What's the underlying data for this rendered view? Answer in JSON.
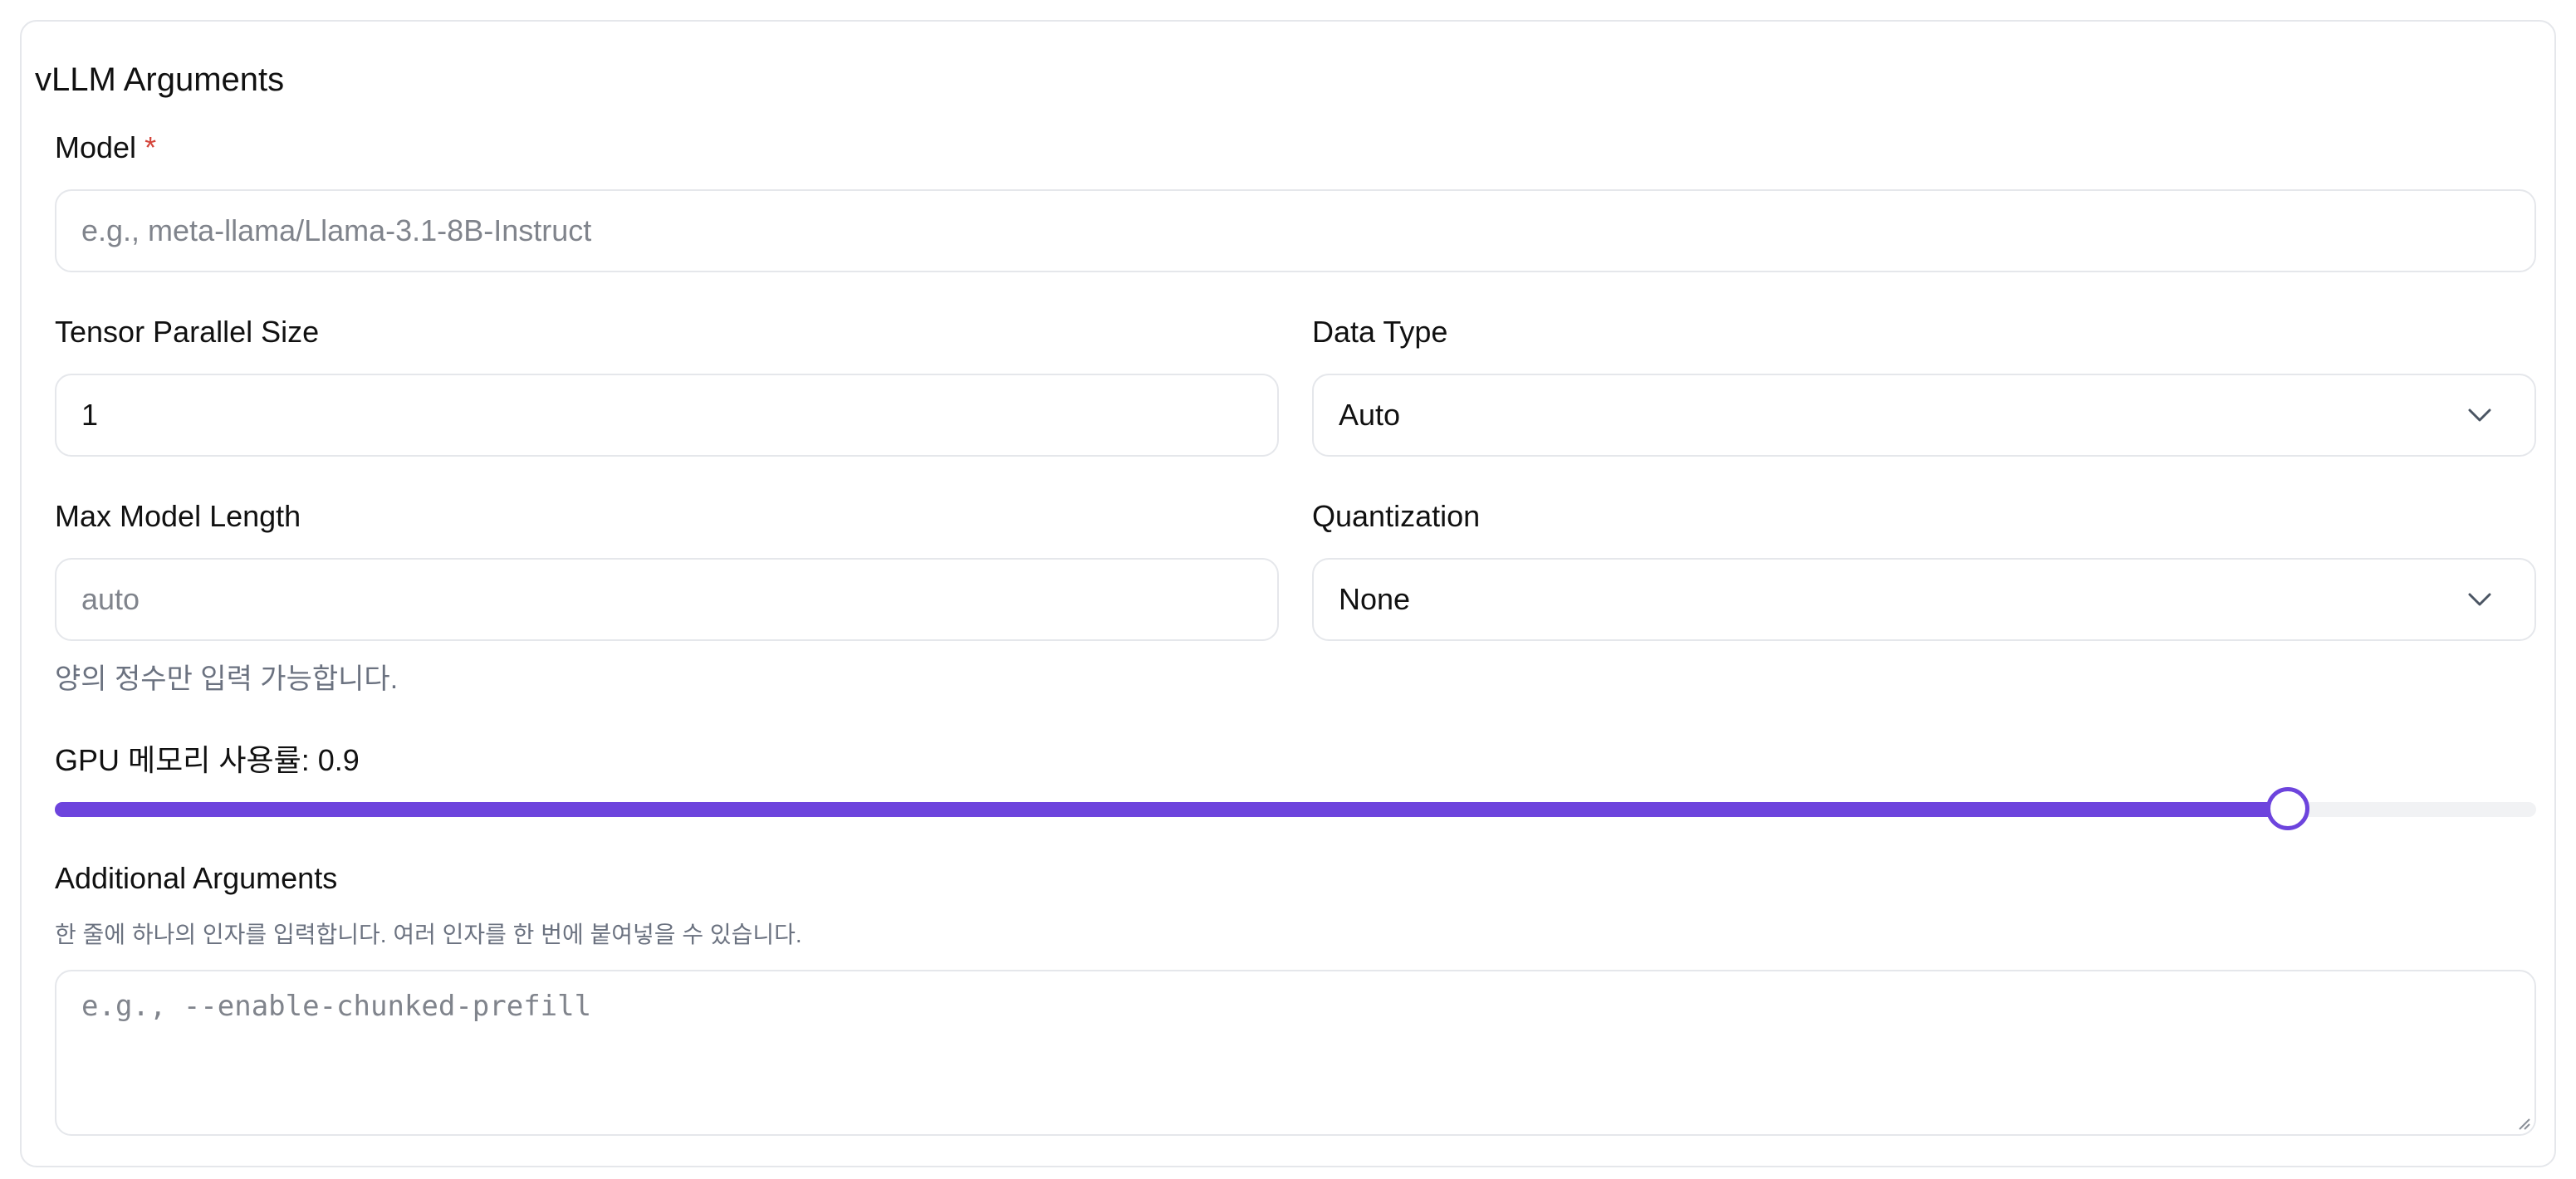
{
  "section": {
    "title": "vLLM Arguments"
  },
  "model": {
    "label": "Model",
    "required_mark": "*",
    "placeholder": "e.g., meta-llama/Llama-3.1-8B-Instruct",
    "value": ""
  },
  "tensor_parallel": {
    "label": "Tensor Parallel Size",
    "value": "1"
  },
  "data_type": {
    "label": "Data Type",
    "selected": "Auto",
    "icon": "chevron-down-icon"
  },
  "max_model_length": {
    "label": "Max Model Length",
    "placeholder": "auto",
    "value": "",
    "hint": "양의 정수만 입력 가능합니다."
  },
  "quantization": {
    "label": "Quantization",
    "selected": "None",
    "icon": "chevron-down-icon"
  },
  "gpu_memory": {
    "label": "GPU 메모리 사용률: 0.9",
    "value": 0.9,
    "min": 0,
    "max": 1,
    "accent_color": "#6d44dd"
  },
  "additional_args": {
    "label": "Additional Arguments",
    "hint": "한 줄에 하나의 인자를 입력합니다. 여러 인자를 한 번에 붙여넣을 수 있습니다.",
    "placeholder": "e.g., --enable-chunked-prefill",
    "value": ""
  }
}
